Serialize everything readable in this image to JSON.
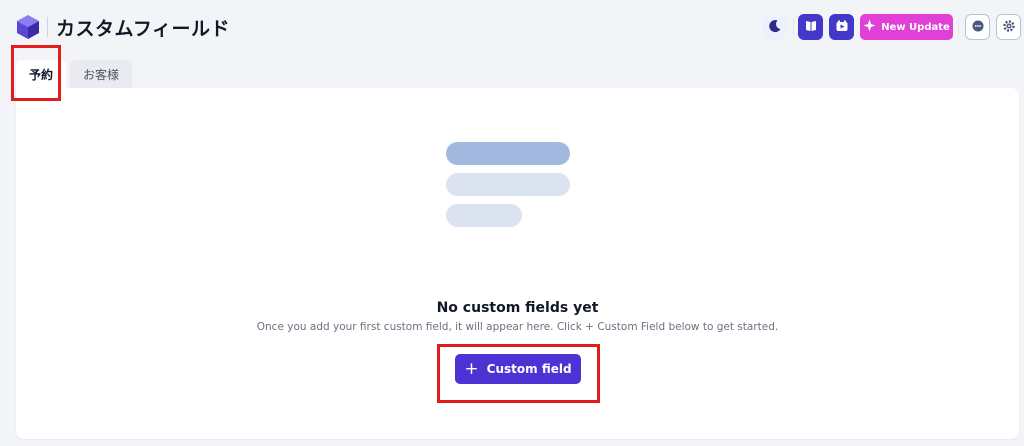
{
  "header": {
    "title": "カスタムフィールド",
    "new_update_label": "New Update"
  },
  "tabs": [
    {
      "label": "予約",
      "active": true
    },
    {
      "label": "お客様",
      "active": false
    }
  ],
  "empty_state": {
    "title": "No custom fields yet",
    "description": "Once you add your first custom field, it will appear here. Click + Custom Field below to get started.",
    "button_icon": "+",
    "button_label": "Custom field"
  },
  "colors": {
    "accent": "#4b33d4",
    "update_pink": "#e040d6",
    "annotation_red": "#e11d1d"
  },
  "icons": [
    "logo-icon",
    "moon-icon",
    "book-icon",
    "video-icon",
    "sparkle-icon",
    "chat-icon",
    "gear-icon",
    "plus-icon"
  ]
}
